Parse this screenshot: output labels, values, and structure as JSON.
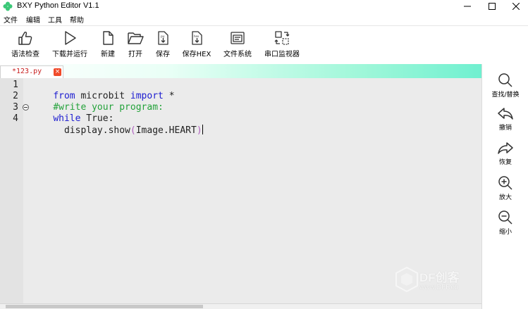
{
  "window": {
    "title": "BXY Python Editor V1.1",
    "icon": "clover-icon",
    "accent": "#3cc878"
  },
  "menu": [
    "文件",
    "编辑",
    "工具",
    "帮助"
  ],
  "toolbar": [
    {
      "label": "语法检查",
      "icon": "thumbs-up-icon"
    },
    {
      "label": "下载并运行",
      "icon": "play-icon"
    },
    {
      "label": "新建",
      "icon": "new-file-icon"
    },
    {
      "label": "打开",
      "icon": "folder-open-icon"
    },
    {
      "label": "保存",
      "icon": "save-py-icon"
    },
    {
      "label": "保存HEX",
      "icon": "save-hex-icon"
    },
    {
      "label": "文件系统",
      "icon": "file-system-icon"
    },
    {
      "label": "串口监视器",
      "icon": "serial-monitor-icon"
    }
  ],
  "tab": {
    "title": "*123.py",
    "close": "×"
  },
  "editor": {
    "line_numbers": [
      "1",
      "2",
      "3",
      "4"
    ],
    "lines": [
      [
        {
          "t": "from",
          "c": "kw"
        },
        {
          "t": " microbit ",
          "c": "pl"
        },
        {
          "t": "import",
          "c": "kw"
        },
        {
          "t": " *",
          "c": "pl"
        }
      ],
      [
        {
          "t": "#write your program:",
          "c": "cm"
        }
      ],
      [
        {
          "t": "while",
          "c": "kw"
        },
        {
          "t": " True:",
          "c": "pl"
        }
      ],
      [
        {
          "t": "  display.show",
          "c": "pl"
        },
        {
          "t": "(",
          "c": "par"
        },
        {
          "t": "Image.HEART",
          "c": "pl"
        },
        {
          "t": ")",
          "c": "par"
        }
      ]
    ],
    "colors": {
      "keyword": "#1c1cd0",
      "comment": "#23a23a",
      "background": "#ebebeb"
    }
  },
  "side_tools": [
    {
      "label": "查找/替换",
      "icon": "search-icon"
    },
    {
      "label": "撤销",
      "icon": "undo-icon"
    },
    {
      "label": "恢复",
      "icon": "redo-icon"
    },
    {
      "label": "放大",
      "icon": "zoom-in-icon"
    },
    {
      "label": "缩小",
      "icon": "zoom-out-icon"
    }
  ],
  "watermark": {
    "text": "DF创客",
    "sub": "www.DFRob"
  }
}
